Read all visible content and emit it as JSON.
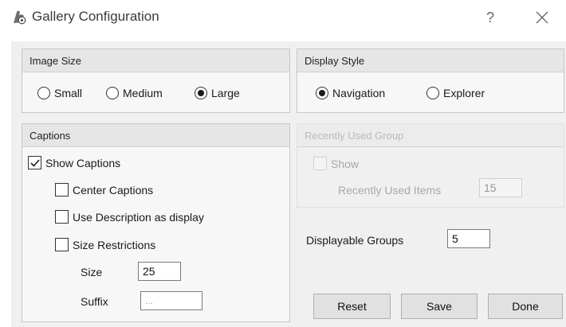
{
  "window": {
    "title": "Gallery Configuration",
    "help_label": "?",
    "app_icon": "gallery-config-icon",
    "close_icon": "close-x-icon"
  },
  "image_size": {
    "header": "Image Size",
    "options": [
      "Small",
      "Medium",
      "Large"
    ],
    "selected": "Large"
  },
  "display_style": {
    "header": "Display Style",
    "options": [
      "Navigation",
      "Explorer"
    ],
    "selected": "Navigation"
  },
  "captions": {
    "header": "Captions",
    "show_captions": {
      "label": "Show Captions",
      "checked": true
    },
    "center_captions": {
      "label": "Center Captions",
      "checked": false
    },
    "use_description": {
      "label": "Use Description as display",
      "checked": false
    },
    "size_restrictions": {
      "label": "Size Restrictions",
      "checked": false
    },
    "size_label": "Size",
    "size_value": "25",
    "suffix_label": "Suffix",
    "suffix_placeholder": "..."
  },
  "recently_used": {
    "header": "Recently Used Group",
    "enabled": false,
    "show": {
      "label": "Show",
      "checked": false
    },
    "items_label": "Recently Used Items",
    "items_value": "15"
  },
  "displayable_groups": {
    "label": "Displayable Groups",
    "value": "5"
  },
  "buttons": {
    "reset": "Reset",
    "save": "Save",
    "done": "Done"
  }
}
